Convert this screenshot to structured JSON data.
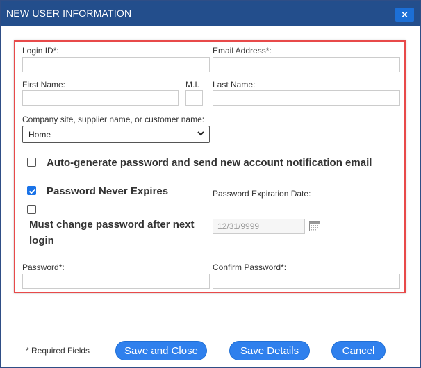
{
  "dialog": {
    "title": "NEW USER INFORMATION",
    "close": "×"
  },
  "form": {
    "login_id_label": "Login ID*:",
    "login_id_value": "",
    "email_label": "Email Address*:",
    "email_value": "",
    "first_name_label": "First Name:",
    "first_name_value": "",
    "mi_label": "M.I.",
    "mi_value": "",
    "last_name_label": "Last Name:",
    "last_name_value": "",
    "company_label": "Company site, supplier name, or customer name:",
    "company_selected": "Home",
    "auto_generate_label": "Auto-generate password and send new account notification email",
    "auto_generate_checked": false,
    "never_expires_label": "Password Never Expires",
    "never_expires_checked": true,
    "must_change_label_line1": "Must change password after next",
    "must_change_label_line2": "login",
    "must_change_checked": false,
    "expiration_label": "Password Expiration Date:",
    "expiration_value": "12/31/9999",
    "password_label": "Password*:",
    "password_value": "",
    "confirm_label": "Confirm Password*:",
    "confirm_value": ""
  },
  "footer": {
    "required_note": "* Required Fields",
    "save_close": "Save and Close",
    "save_details": "Save Details",
    "cancel": "Cancel"
  },
  "colors": {
    "title_bar": "#234e8c",
    "close_button": "#1c6fd6",
    "highlight_frame": "#e84a4a",
    "button": "#2f80ed",
    "checkbox_checked": "#1a73e8"
  },
  "icons": {
    "close": "close-icon",
    "dropdown": "chevron-down-icon",
    "calendar": "calendar-icon",
    "checkmark": "checkmark-icon"
  }
}
